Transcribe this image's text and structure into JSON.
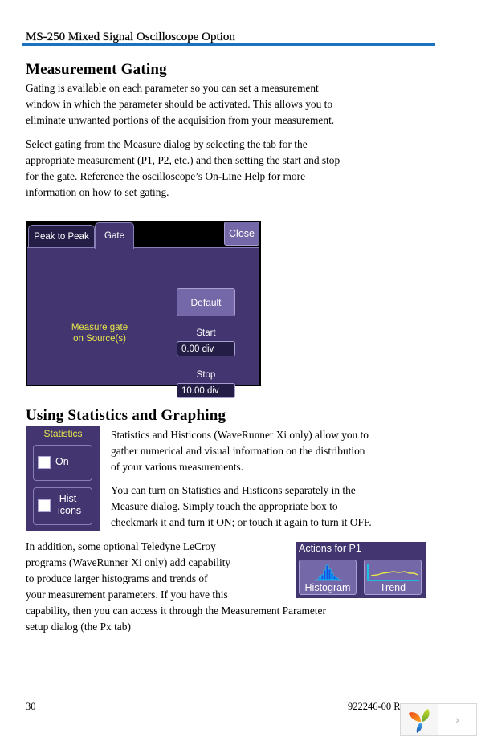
{
  "header": {
    "running_title": "MS-250 Mixed Signal Oscilloscope Option",
    "rule_color": "#1a72c0"
  },
  "section1": {
    "heading": "Measurement Gating",
    "para1": [
      "Gating is available on each parameter so you can set a measurement",
      "window in which the parameter should be activated. This allows you to",
      "eliminate unwanted portions of the acquisition from your measurement."
    ],
    "para2": [
      "Select gating from the Measure dialog by selecting the tab for the",
      "appropriate measurement (P1, P2, etc.) and then setting the start and stop",
      "for the gate. Reference the oscilloscope’s On-Line Help for more",
      "information on how to set gating."
    ]
  },
  "measure_dialog": {
    "tabs": [
      {
        "label": "Peak to Peak",
        "active": false
      },
      {
        "label": "Gate",
        "active": true
      }
    ],
    "close_label": "Close",
    "default_label": "Default",
    "gate_label_line1": "Measure gate",
    "gate_label_line2": "on Source(s)",
    "start_label": "Start",
    "start_value": "0.00 div",
    "stop_label": "Stop",
    "stop_value": "10.00 div",
    "colors": {
      "panel": "#433670",
      "button": "#7568a8",
      "field": "#241d46",
      "accent_text": "#e8e84a"
    }
  },
  "section2": {
    "heading": "Using Statistics and Graphing",
    "para1": [
      "Statistics and Histicons (WaveRunner Xi only) allow you to",
      "gather numerical and visual information on the distribution",
      "of your various measurements."
    ],
    "para2": [
      "You can turn on Statistics and Histicons separately in the",
      "Measure dialog. Simply touch the appropriate box to",
      "checkmark it and turn it ON; or touch it again to turn it OFF."
    ],
    "para3": [
      "In addition, some optional Teledyne LeCroy",
      "programs (WaveRunner Xi only) add capability",
      "to produce larger histograms and trends of",
      "your measurement parameters. If you have this",
      "capability, then you can access it through the Measurement Parameter",
      "setup dialog (the Px tab)"
    ]
  },
  "statistics_panel": {
    "title": "Statistics",
    "on_label": "On",
    "on_checked": false,
    "histicons_label_line1": "Hist-",
    "histicons_label_line2": "icons",
    "histicons_checked": false
  },
  "actions_panel": {
    "title": "Actions for P1",
    "histogram_label": "Histogram",
    "trend_label": "Trend"
  },
  "footer": {
    "page_number": "30",
    "doc_number": "922246-00 R",
    "next_glyph": "›"
  }
}
